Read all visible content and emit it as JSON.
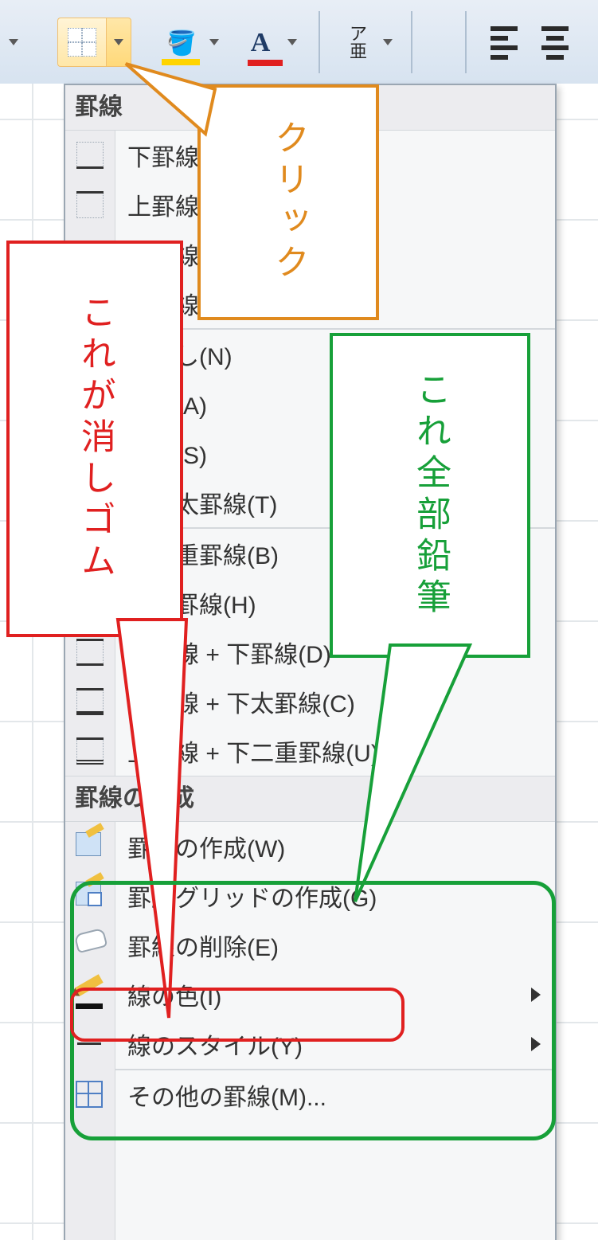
{
  "ribbon": {
    "borders_button": "罫線ドロップダウン",
    "fill_button": "塗りつぶし",
    "font_color_button": "フォントの色",
    "orientation_button": "ア\n亜",
    "align_left": "左揃え",
    "align_center": "中央揃え"
  },
  "menu": {
    "section1": "罫線",
    "items1": [
      {
        "label": "下罫線(O)",
        "icon": "border-bottom-icon"
      },
      {
        "label": "上罫線(P)",
        "icon": "border-top-icon"
      },
      {
        "label": "左罫線(L)",
        "icon": "border-left-icon"
      },
      {
        "label": "右罫線(R)",
        "icon": "border-right-icon"
      },
      {
        "label": "枠なし(N)",
        "icon": "border-none-icon"
      },
      {
        "label": "格子(A)",
        "icon": "border-all-icon"
      },
      {
        "label": "外枠(S)",
        "icon": "border-outside-icon"
      },
      {
        "label": "外枠太罫線(T)",
        "icon": "border-thick-box-icon"
      },
      {
        "label": "下二重罫線(B)",
        "icon": "border-bottom-double-icon"
      },
      {
        "label": "下太罫線(H)",
        "icon": "border-bottom-thick-icon"
      },
      {
        "label": "上罫線 + 下罫線(D)",
        "icon": "border-top-bottom-icon"
      },
      {
        "label": "上罫線 + 下太罫線(C)",
        "icon": "border-top-thick-bottom-icon"
      },
      {
        "label": "上罫線 + 下二重罫線(U)",
        "icon": "border-top-double-bottom-icon"
      }
    ],
    "section2": "罫線の作成",
    "items2": [
      {
        "label": "罫線の作成(W)",
        "icon": "draw-border-icon",
        "arrow": false
      },
      {
        "label": "罫線グリッドの作成(G)",
        "icon": "draw-border-grid-icon",
        "arrow": false
      },
      {
        "label": "罫線の削除(E)",
        "icon": "erase-border-icon",
        "arrow": false
      },
      {
        "label": "線の色(I)",
        "icon": "line-color-icon",
        "arrow": true
      },
      {
        "label": "線のスタイル(Y)",
        "icon": "line-style-icon",
        "arrow": true
      },
      {
        "label": "その他の罫線(M)...",
        "icon": "more-borders-icon",
        "arrow": false
      }
    ]
  },
  "callouts": {
    "click": "クリック",
    "eraser": "これが消しゴム",
    "pencil": "これ全部鉛筆"
  }
}
